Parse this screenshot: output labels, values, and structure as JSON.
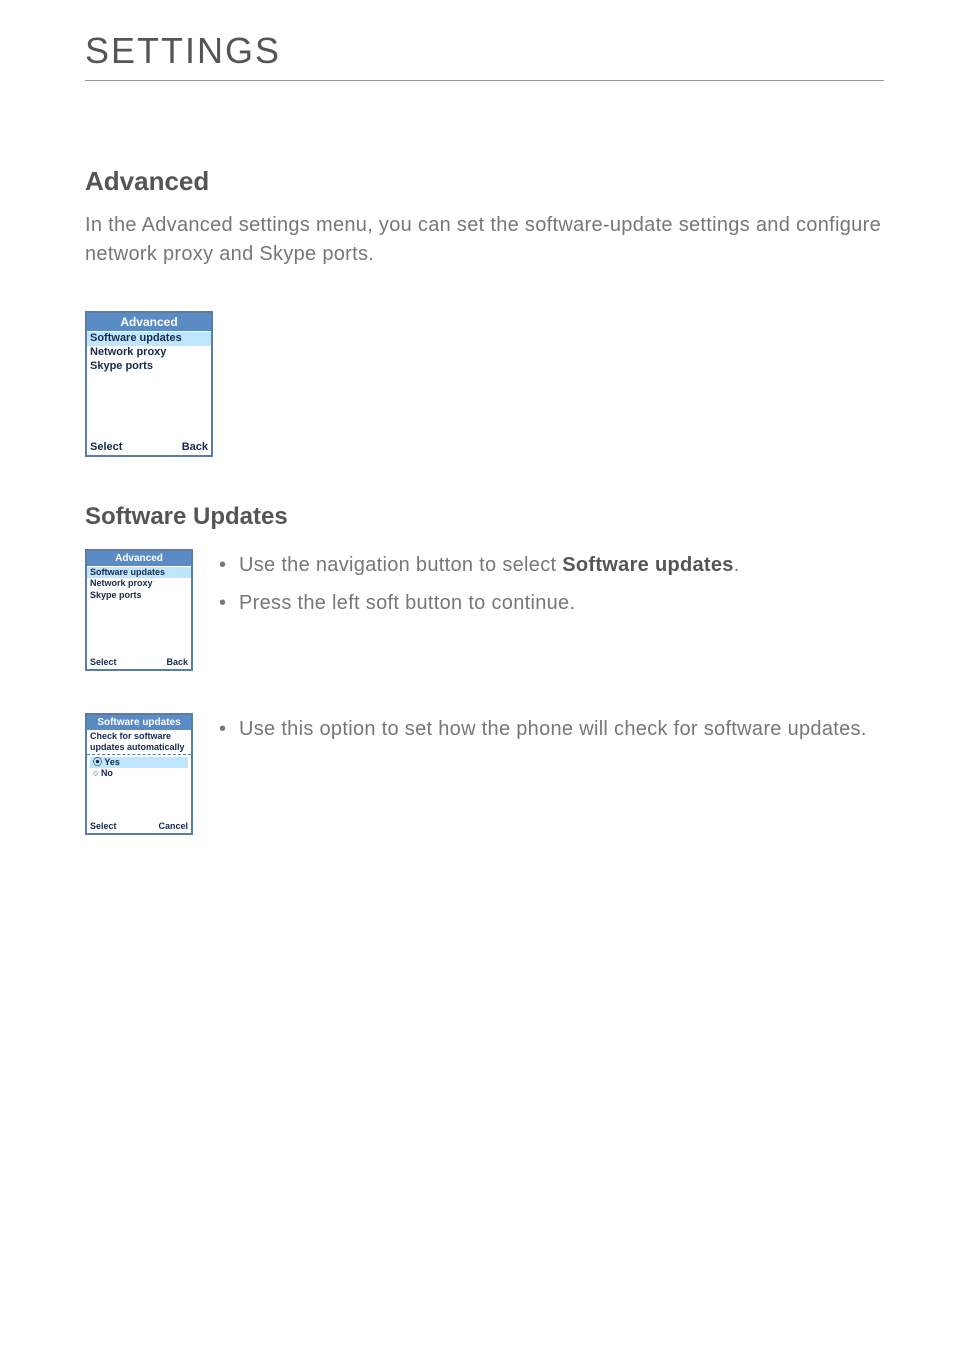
{
  "page": {
    "title": "SETTINGS"
  },
  "section": {
    "advanced_heading": "Advanced",
    "intro": "In the Advanced settings menu, you can set the software-update settings and configure network proxy and Skype ports.",
    "software_updates_heading": "Software Updates"
  },
  "screen1": {
    "header": "Advanced",
    "items": [
      "Software updates",
      "Network proxy",
      "Skype ports"
    ],
    "left": "Select",
    "right": "Back"
  },
  "screen2": {
    "header": "Advanced",
    "items": [
      "Software updates",
      "Network proxy",
      "Skype ports"
    ],
    "left": "Select",
    "right": "Back"
  },
  "screen3": {
    "header": "Software updates",
    "subtitle": "Check for software updates automatically",
    "opt_yes": "Yes",
    "opt_no": "No",
    "left": "Select",
    "right": "Cancel"
  },
  "step1": {
    "b1a": "Use the navigation button to select ",
    "b1b": "Software updates",
    "b1c": ".",
    "b2": "Press the left soft button to continue."
  },
  "step2": {
    "b1": "Use this option to set how the phone will check for software updates."
  }
}
